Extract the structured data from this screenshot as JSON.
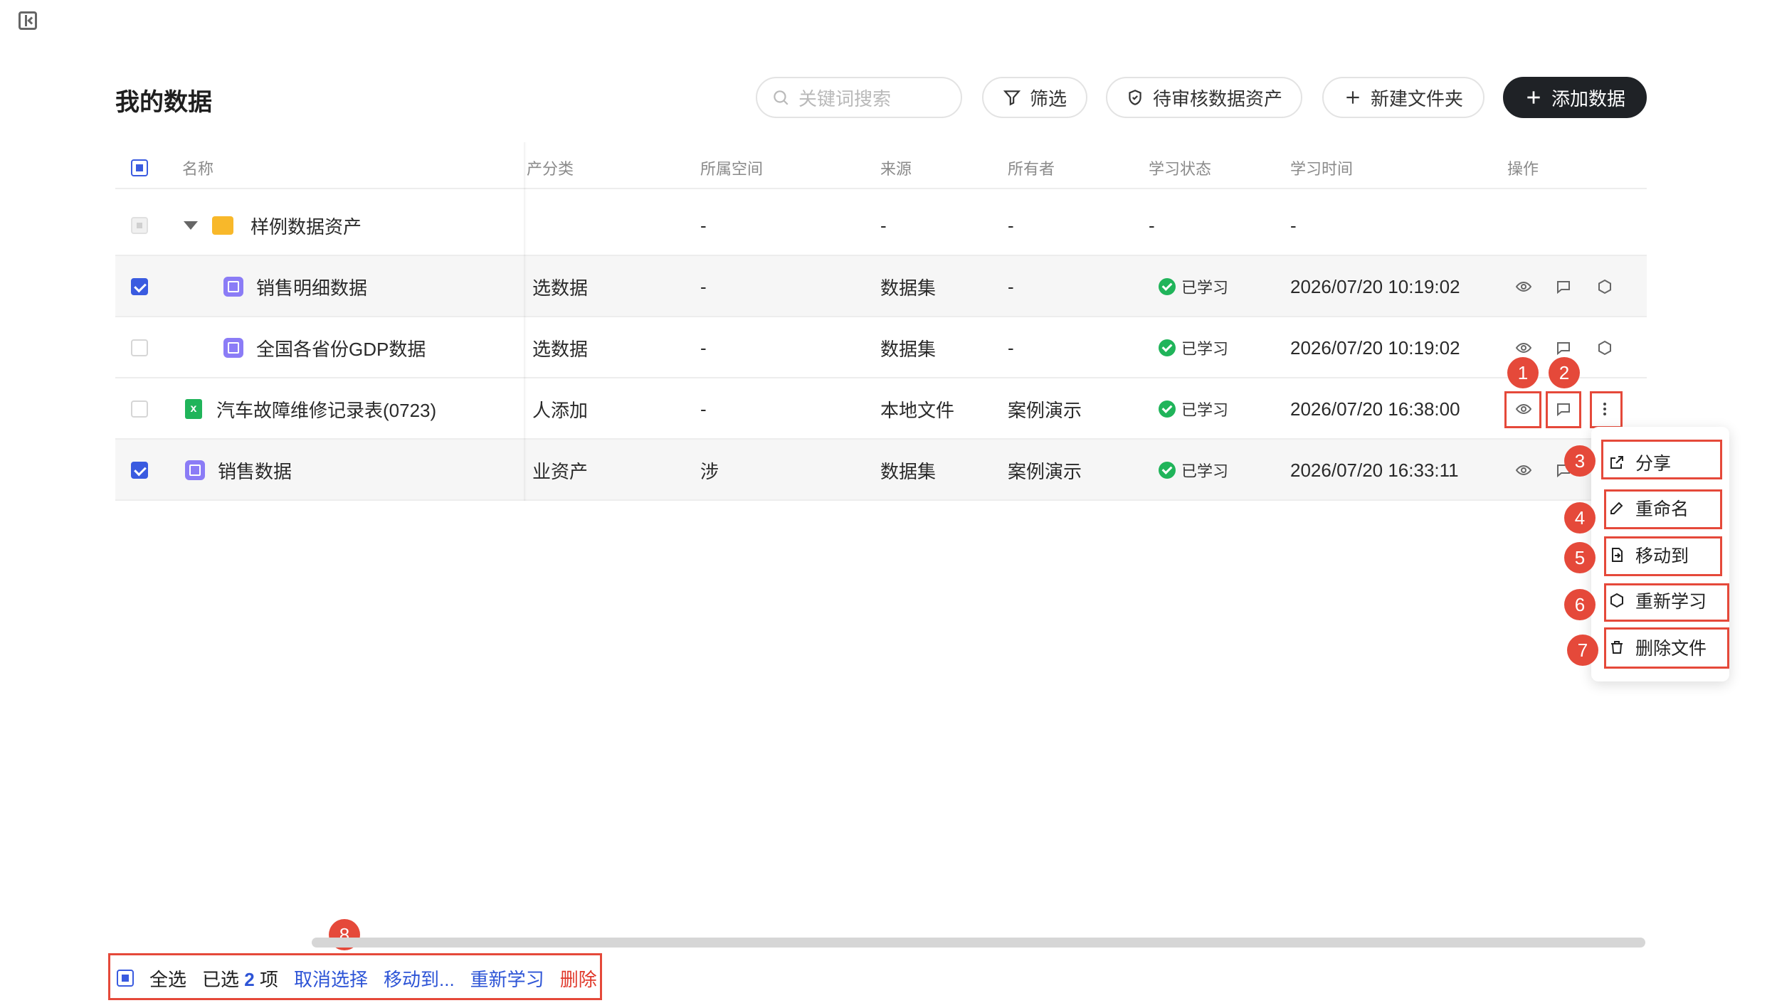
{
  "page": {
    "title": "我的数据"
  },
  "toolbar": {
    "search_placeholder": "关键词搜索",
    "filter_label": "筛选",
    "pending_label": "待审核数据资产",
    "new_folder_label": "新建文件夹",
    "add_data_label": "添加数据"
  },
  "table": {
    "headers": [
      "名称",
      "产分类",
      "所属空间",
      "来源",
      "所有者",
      "学习状态",
      "学习时间",
      "操作"
    ],
    "rows": [
      {
        "name": "样例数据资产",
        "category": "",
        "space": "-",
        "source": "-",
        "owner": "-",
        "status": "-",
        "time": "-",
        "checked": "disabled",
        "type": "folder"
      },
      {
        "name": "销售明细数据",
        "category": "选数据",
        "space": "-",
        "source": "数据集",
        "owner": "-",
        "status": "已学习",
        "time": "2026/07/20 10:19:02",
        "checked": "true",
        "type": "dataset"
      },
      {
        "name": "全国各省份GDP数据",
        "category": "选数据",
        "space": "-",
        "source": "数据集",
        "owner": "-",
        "status": "已学习",
        "time": "2026/07/20 10:19:02",
        "checked": "false",
        "type": "dataset"
      },
      {
        "name": "汽车故障维修记录表(0723)",
        "category": "人添加",
        "space": "-",
        "source": "本地文件",
        "owner": "案例演示",
        "status": "已学习",
        "time": "2026/07/20 16:38:00",
        "checked": "false",
        "type": "excel"
      },
      {
        "name": "销售数据",
        "category": "业资产",
        "space": "涉",
        "source": "数据集",
        "owner": "案例演示",
        "status": "已学习",
        "time": "2026/07/20 16:33:11",
        "checked": "true",
        "type": "dataset"
      }
    ]
  },
  "menu": {
    "items": [
      "分享",
      "重命名",
      "移动到",
      "重新学习",
      "删除文件"
    ]
  },
  "badges": [
    "1",
    "2",
    "3",
    "4",
    "5",
    "6",
    "7",
    "8"
  ],
  "bottom_bar": {
    "select_all": "全选",
    "selected_prefix": "已选",
    "selected_count": "2",
    "selected_suffix": "项",
    "cancel": "取消选择",
    "move": "移动到...",
    "relearn": "重新学习",
    "delete": "删除"
  },
  "colors": {
    "primary": "#3a5be0",
    "accent": "#e5493a",
    "dark_button": "#1f2226",
    "success": "#20b45a"
  }
}
